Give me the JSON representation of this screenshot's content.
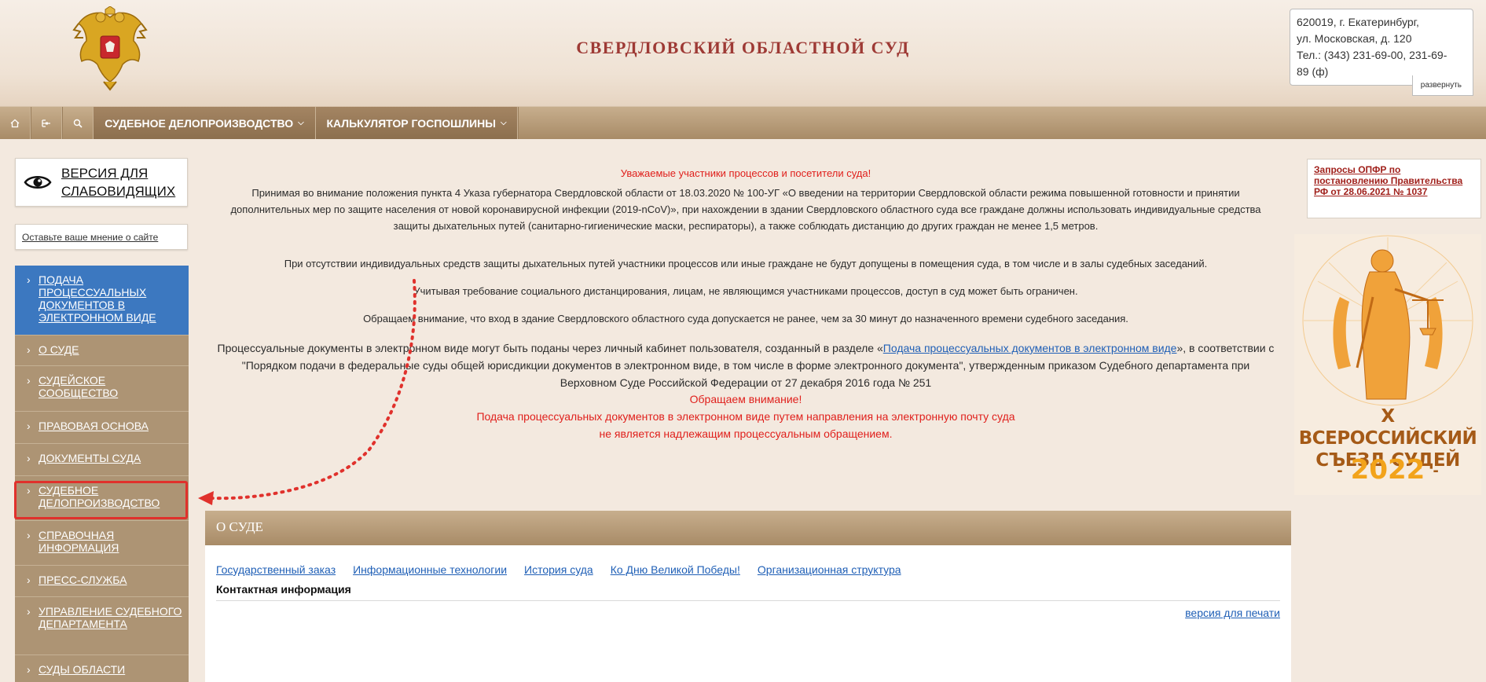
{
  "header": {
    "title": "СВЕРДЛОВСКИЙ ОБЛАСТНОЙ СУД",
    "address_lines": [
      "620019, г. Екатеринбург,",
      "ул. Московская, д. 120",
      "Тел.: (343) 231-69-00, 231-69-",
      "89 (ф)"
    ],
    "expand_label": "развернуть"
  },
  "nav": {
    "home_icon": "home-icon",
    "sitemap_icon": "sitemap-icon",
    "search_icon": "search-icon",
    "items": [
      {
        "label": "СУДЕБНОЕ ДЕЛОПРОИЗВОДСТВО"
      },
      {
        "label": "КАЛЬКУЛЯТОР ГОСПОШЛИНЫ"
      }
    ]
  },
  "left": {
    "vision_label_line1": "ВЕРСИЯ ДЛЯ",
    "vision_label_line2": "СЛАБОВИДЯЩИХ",
    "feedback_label": "Оставьте ваше мнение о сайте",
    "menu": [
      "ПОДАЧА ПРОЦЕССУАЛЬНЫХ ДОКУМЕНТОВ В ЭЛЕКТРОННОМ ВИДЕ",
      "О СУДЕ",
      "СУДЕЙСКОЕ СООБЩЕСТВО",
      "ПРАВОВАЯ ОСНОВА",
      "ДОКУМЕНТЫ СУДА",
      "СУДЕБНОЕ ДЕЛОПРОИЗВОДСТВО",
      "СПРАВОЧНАЯ ИНФОРМАЦИЯ",
      "ПРЕСС-СЛУЖБА",
      "УПРАВЛЕНИЕ СУДЕБНОГО ДЕПАРТАМЕНТА",
      "СУДЫ ОБЛАСТИ"
    ]
  },
  "notice": {
    "greeting": "Уважаемые участники процессов и посетители суда!",
    "p1": "Принимая во внимание положения пункта 4 Указа губернатора Свердловской области от 18.03.2020 № 100-УГ «О введении на территории Свердловской области режима повышенной готовности и принятии дополнительных мер по защите населения от новой коронавирусной инфекции (2019-nCoV)», при нахождении в здании Свердловского областного суда все граждане должны использовать индивидуальные средства защиты дыхательных путей (санитарно-гигиенические маски, респираторы), а также соблюдать дистанцию до других граждан не менее 1,5 метров.",
    "p2": "При отсутствии индивидуальных средств защиты дыхательных путей участники процессов или иные граждане не будут допущены в помещения суда, в том числе и в залы судебных заседаний.",
    "p3": "Учитывая требование социального дистанцирования, лицам, не являющимся участниками процессов, доступ в суд может быть ограничен.",
    "p4": "Обращаем внимание, что вход в здание Свердловского областного суда допускается не ранее, чем за 30 минут до назначенного времени судебного заседания.",
    "p5_before": "Процессуальные документы в электронном виде могут быть поданы через личный кабинет пользователя, созданный в разделе «",
    "p5_link": "Подача процессуальных документов в электронном виде",
    "p5_after": "», в соответствии с \"Порядком подачи в федеральные суды общей юрисдикции документов в электронном виде, в том числе в форме электронного документа\", утвержденным приказом Судебного департамента при Верховном Суде Российской Федерации от 27 декабря 2016 года № 251",
    "attention": "Обращаем внимание!",
    "warn1": "Подача процессуальных документов в электронном виде путем направления на электронную почту суда",
    "warn2": "не является надлежащим процессуальным обращением."
  },
  "about": {
    "title": "О СУДЕ",
    "links": [
      "Государственный заказ",
      "Информационные технологии",
      "История суда",
      "Ко Дню Великой Победы!",
      "Организационная структура"
    ],
    "contact_tab": "Контактная информация",
    "print_label": "версия для печати"
  },
  "right": {
    "pfr_text": "Запросы ОПФР по постановлению Правительства РФ от 28.06.2021 № 1037",
    "congress_line1": "X ВСЕРОССИЙСКИЙ",
    "congress_line2": "СЪЕЗД СУДЕЙ",
    "congress_year": "2022"
  },
  "colors": {
    "brand_brown": "#a88b67",
    "active_blue": "#3c78c0",
    "title_red": "#9e3a35",
    "alert_red": "#e0201c",
    "annotation_red": "#e0312c"
  }
}
